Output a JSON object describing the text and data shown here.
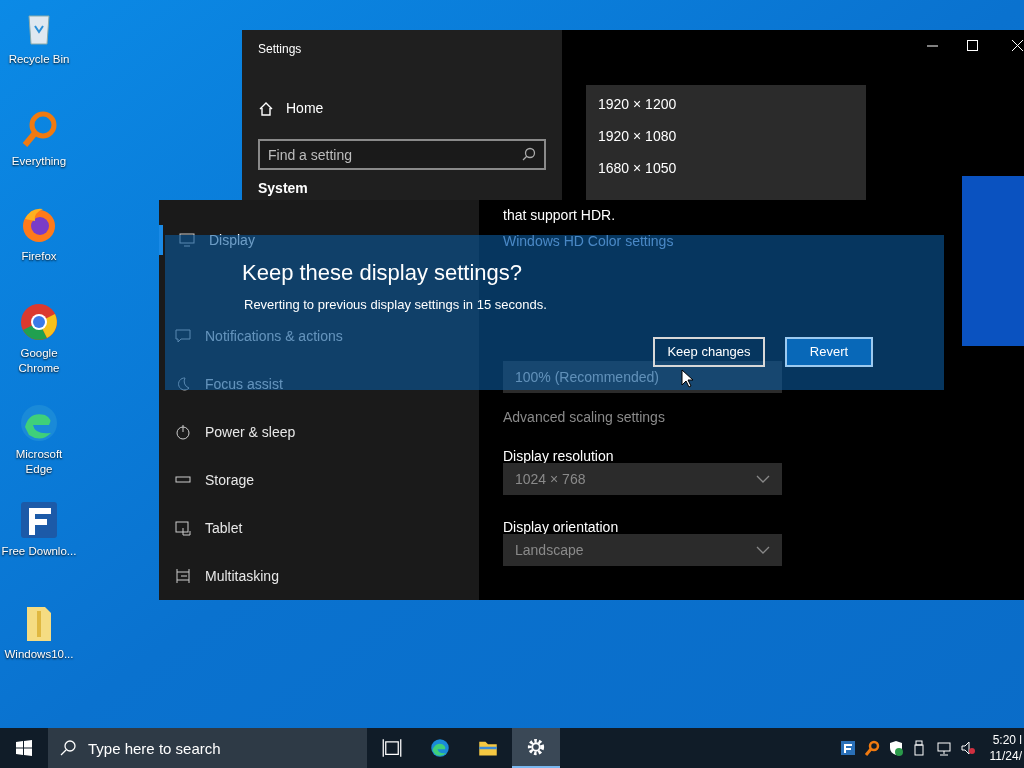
{
  "desktop_icons": [
    {
      "label": "Recycle Bin",
      "kind": "bin"
    },
    {
      "label": "Everything",
      "kind": "search"
    },
    {
      "label": "Firefox",
      "kind": "firefox"
    },
    {
      "label": "Google Chrome",
      "kind": "chrome"
    },
    {
      "label": "Microsoft Edge",
      "kind": "edge"
    },
    {
      "label": "Free Downlo...",
      "kind": "download"
    },
    {
      "label": "Windows10...",
      "kind": "folder"
    }
  ],
  "settings_window": {
    "title": "Settings",
    "home": "Home",
    "search": {
      "placeholder": "Find a setting"
    },
    "section": "System"
  },
  "resolution_list": [
    "1920 × 1200",
    "1920 × 1080",
    "1680 × 1050"
  ],
  "nav_items": [
    {
      "label": "Display",
      "selected": true,
      "kind": "display"
    },
    {
      "label": "Notifications & actions",
      "selected": false,
      "kind": "message"
    },
    {
      "label": "Focus assist",
      "selected": false,
      "kind": "moon"
    },
    {
      "label": "Power & sleep",
      "selected": false,
      "kind": "power"
    },
    {
      "label": "Storage",
      "selected": false,
      "kind": "storage"
    },
    {
      "label": "Tablet",
      "selected": false,
      "kind": "tablet"
    },
    {
      "label": "Multitasking",
      "selected": false,
      "kind": "multi"
    }
  ],
  "content": {
    "hdr_text": "that support HDR.",
    "hdr_link": "Windows HD Color settings",
    "scaling_value": "100% (Recommended)",
    "advanced_link": "Advanced scaling settings",
    "resolution": {
      "label": "Display resolution",
      "value": "1024 × 768"
    },
    "orientation": {
      "label": "Display orientation",
      "value": "Landscape"
    }
  },
  "dialog": {
    "title": "Keep these display settings?",
    "message": "Reverting to previous display settings in 15 seconds.",
    "buttons": [
      {
        "label": "Keep changes",
        "kind": "secondary"
      },
      {
        "label": "Revert",
        "kind": "primary"
      }
    ]
  },
  "taskbar": {
    "search": {
      "placeholder": "Type here to search"
    },
    "apps": [
      {
        "kind": "taskview",
        "selected": false
      },
      {
        "kind": "edge",
        "selected": false
      },
      {
        "kind": "folder",
        "selected": false
      },
      {
        "kind": "settings",
        "selected": true
      }
    ],
    "time": "5:20 l",
    "date": "11/24/"
  }
}
